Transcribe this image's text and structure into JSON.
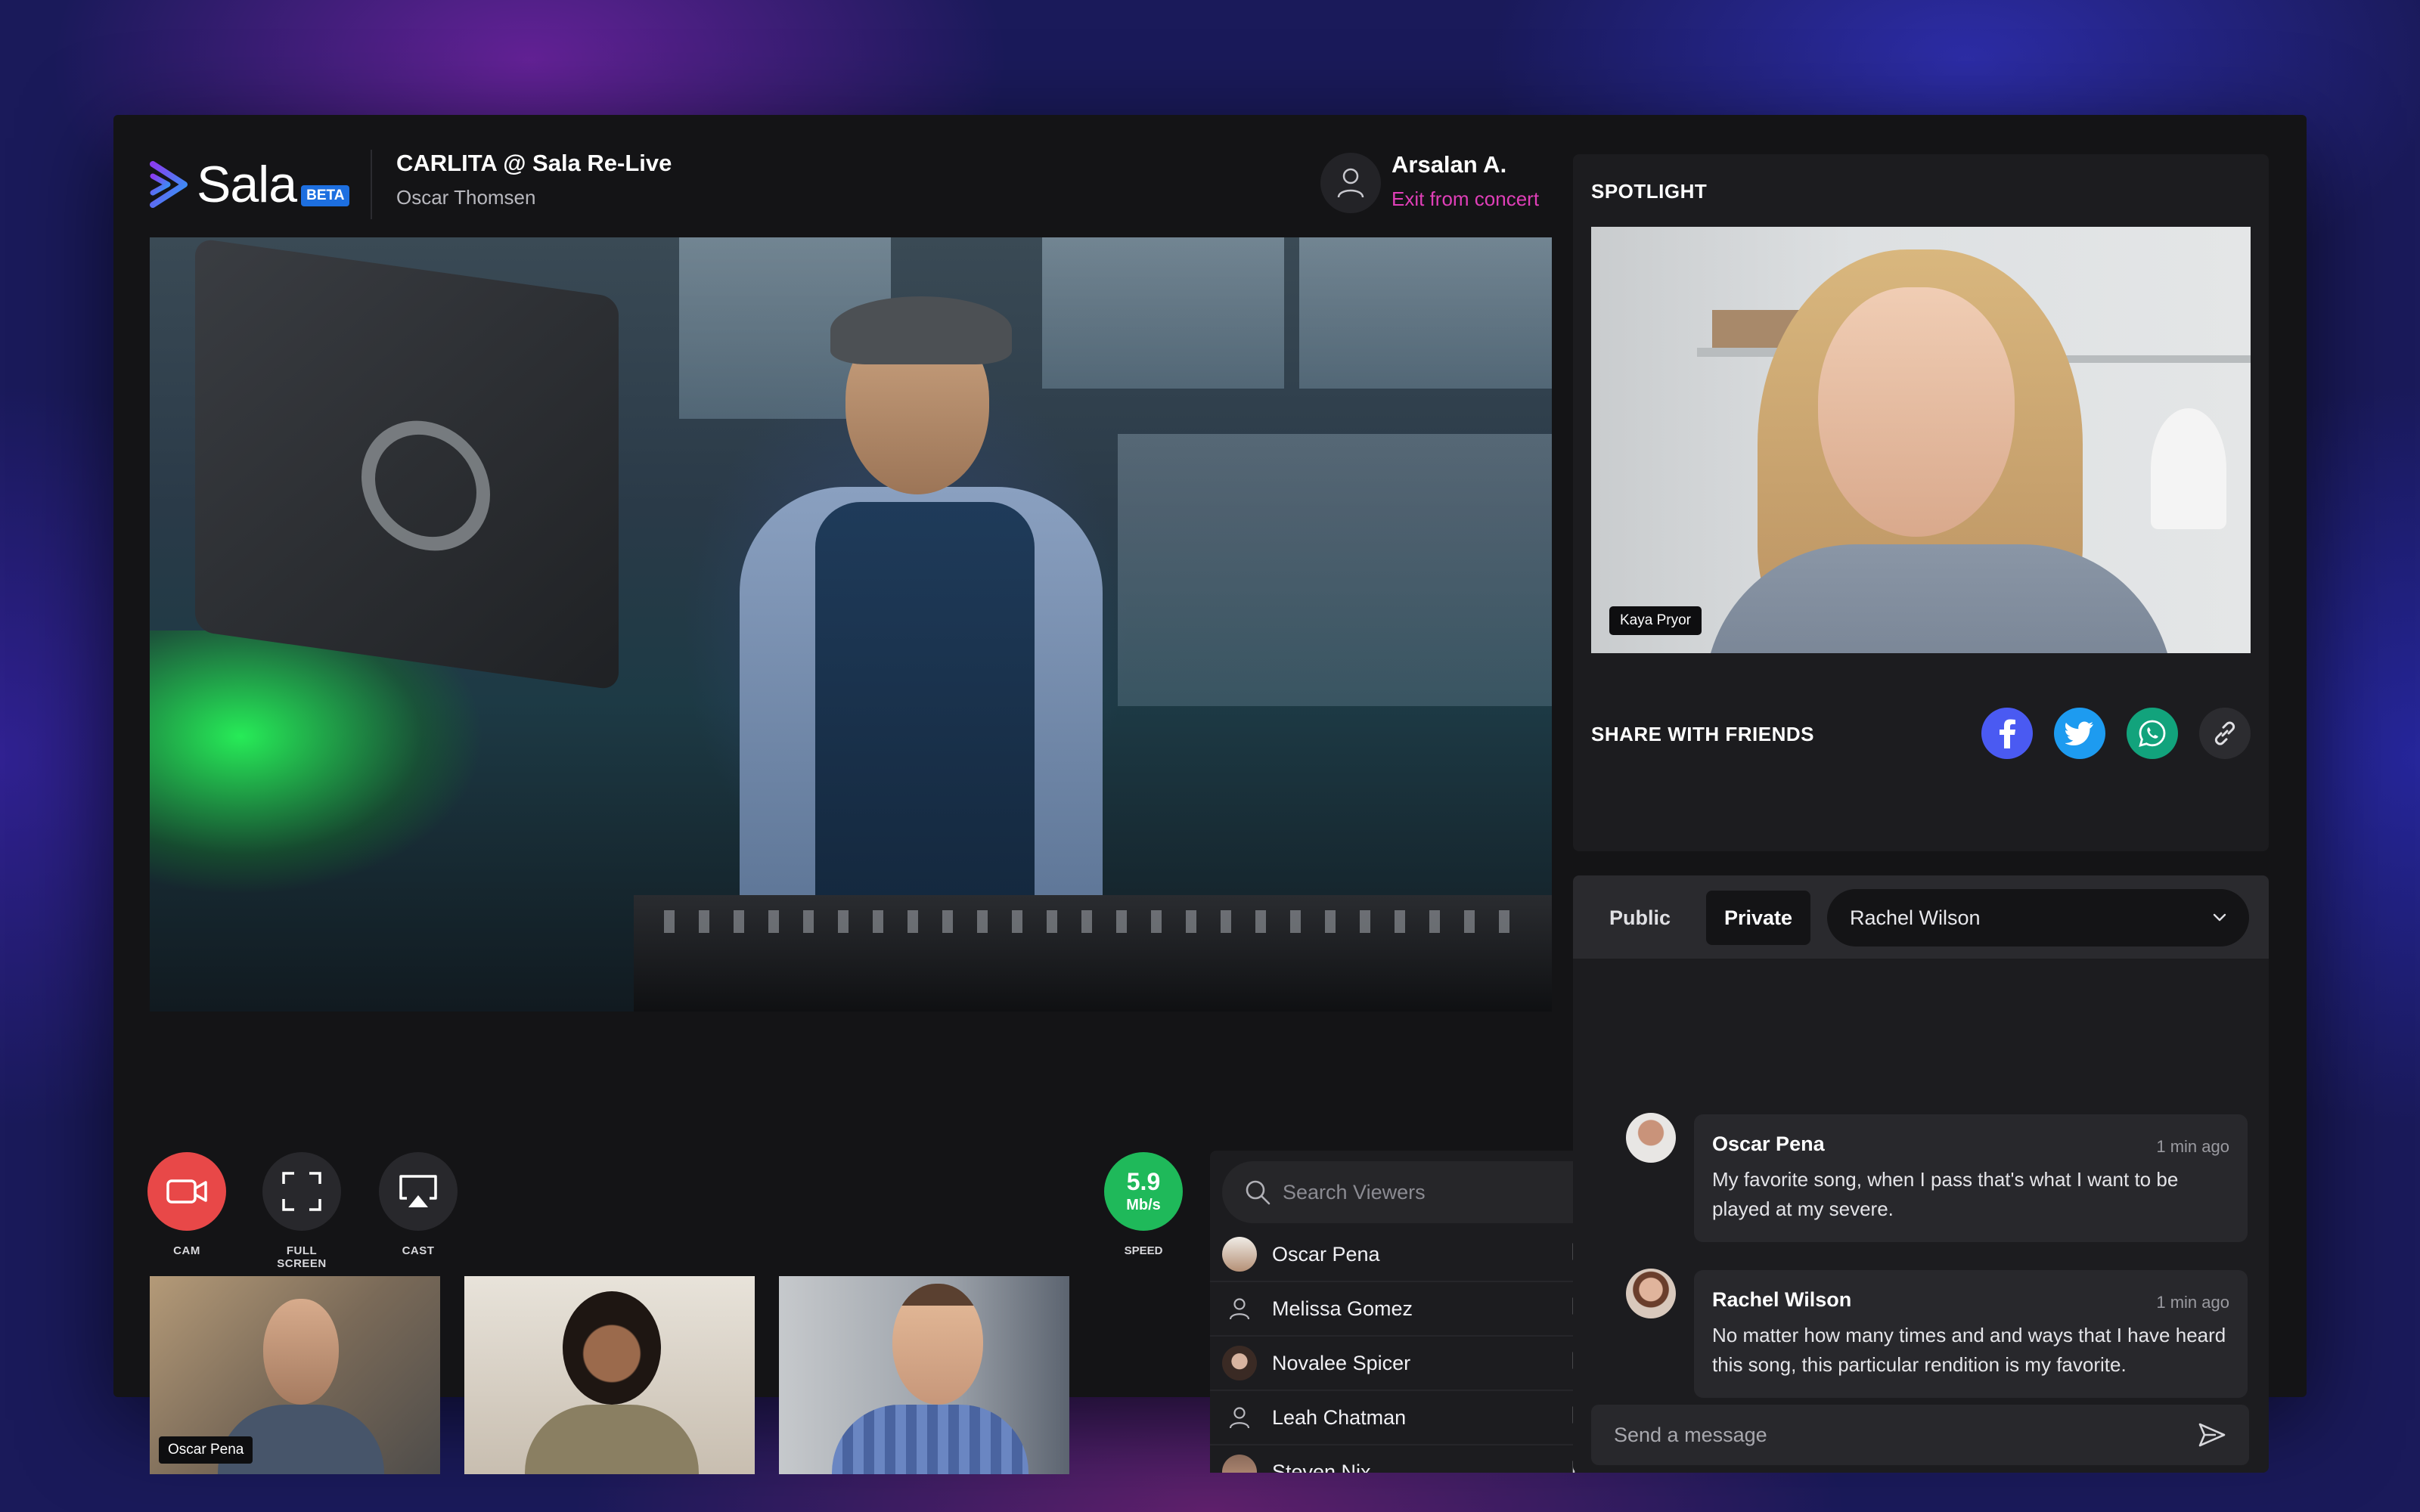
{
  "brand": {
    "name": "Sala",
    "badge": "BETA"
  },
  "event": {
    "title": "CARLITA @ Sala Re-Live",
    "artist": "Oscar Thomsen"
  },
  "user": {
    "name": "Arsalan A.",
    "exit_label": "Exit from concert"
  },
  "controls": {
    "cam_label": "CAM",
    "fullscreen_label": "FULL SCREEN",
    "cast_label": "CAST",
    "speed_value": "5.9",
    "speed_unit": "Mb/s",
    "speed_label": "SPEED"
  },
  "thumbnails": [
    {
      "name": "Oscar Pena"
    }
  ],
  "viewers": {
    "search_placeholder": "Search Viewers",
    "list": [
      {
        "name": "Oscar Pena",
        "video": "on"
      },
      {
        "name": "Melissa Gomez",
        "video": "off"
      },
      {
        "name": "Novalee Spicer",
        "video": "off"
      },
      {
        "name": "Leah Chatman",
        "video": "on"
      },
      {
        "name": "Steven Nix",
        "video": "on"
      }
    ]
  },
  "spotlight": {
    "title": "SPOTLIGHT",
    "person": "Kaya Pryor"
  },
  "share": {
    "title": "SHARE WITH FRIENDS"
  },
  "colors": {
    "accent_pink": "#e03fb8",
    "cam_red": "#e84848",
    "speed_green": "#1fb95a",
    "facebook": "#4a5af2",
    "twitter": "#1d9bf0",
    "whatsapp": "#12a37c",
    "video_blue": "#2f8fe8",
    "video_off_red": "#e84848"
  },
  "chat": {
    "tabs": [
      "Public",
      "Private"
    ],
    "active_tab": "Private",
    "recipient": "Rachel Wilson",
    "messages": [
      {
        "author": "Oscar Pena",
        "time": "1 min ago",
        "text": "My favorite song, when I pass that's what I want to be played at my severe."
      },
      {
        "author": "Rachel Wilson",
        "time": "1 min ago",
        "text": "No matter how many times and and ways that I have heard this song, this particular rendition is my favorite."
      }
    ],
    "input_placeholder": "Send a message"
  }
}
